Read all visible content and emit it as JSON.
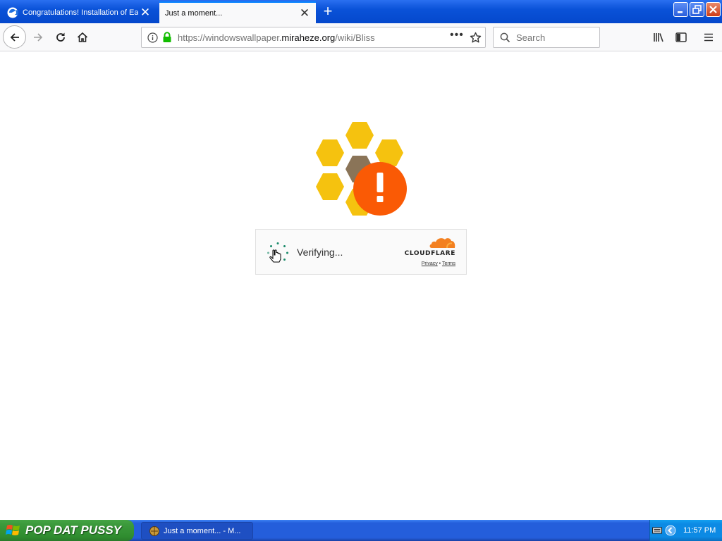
{
  "browser": {
    "tabs": [
      {
        "label": "Congratulations! Installation of Ea",
        "active": false,
        "icon": "edge-style-e-icon"
      },
      {
        "label": "Just a moment...",
        "active": true,
        "icon": ""
      }
    ],
    "new_tab_symbol": "+",
    "url": {
      "prefix": "https://windowswallpaper.",
      "domain": "miraheze.org",
      "path": "/wiki/Bliss"
    },
    "search_placeholder": "Search"
  },
  "page": {
    "verifying_label": "Verifying...",
    "brand": "CLOUDFLARE",
    "privacy_link": "Privacy",
    "link_separator": " • ",
    "terms_link": "Terms",
    "colors": {
      "honeycomb": "#f5c20f",
      "honeycomb_center": "#8a7458",
      "alert": "#fa5a05",
      "cloudflare_orange": "#f38020"
    }
  },
  "taskbar": {
    "start_label": "POP DAT PUSSY",
    "window_item_label": "Just a moment... - M...",
    "clock": "11:57 PM"
  }
}
